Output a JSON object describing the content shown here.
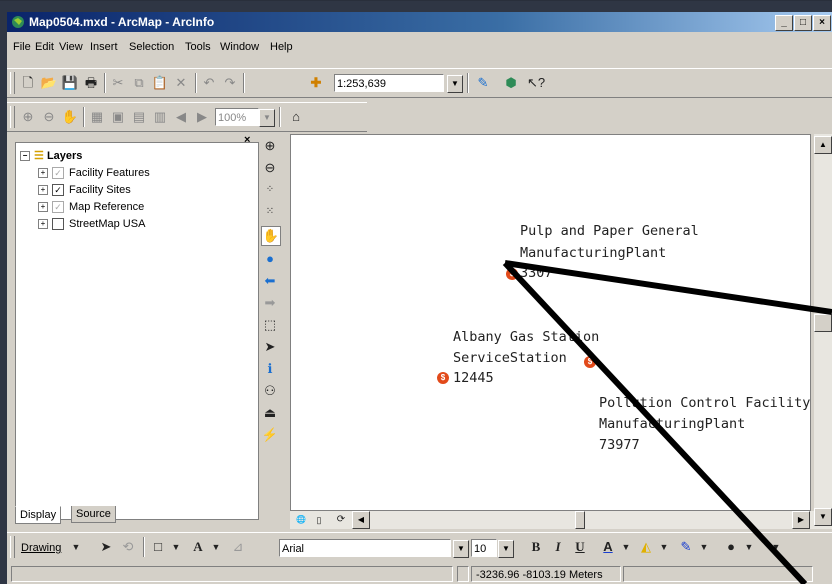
{
  "window": {
    "title": "Map0504.mxd - ArcMap - ArcInfo",
    "buttons": [
      "_",
      "□",
      "×"
    ]
  },
  "menu": [
    "File",
    "Edit",
    "View",
    "Insert",
    "Selection",
    "Tools",
    "Window",
    "Help"
  ],
  "standard_toolbar": {
    "scale": "1:253,639"
  },
  "toc": {
    "root": "Layers",
    "layers": [
      {
        "name": "Facility Features",
        "checked": true,
        "dim": true
      },
      {
        "name": "Facility Sites",
        "checked": true,
        "dim": false
      },
      {
        "name": "Map Reference",
        "checked": true,
        "dim": true
      },
      {
        "name": "StreetMap USA",
        "checked": false,
        "dim": false
      }
    ],
    "tabs": [
      "Display",
      "Source"
    ]
  },
  "map": {
    "labels": {
      "pulp_l1": "Pulp and Paper General",
      "pulp_l2": "ManufacturingPlant",
      "pulp_l3": "3307",
      "albany_l1": "Albany Gas Station",
      "albany_l2": "ServiceStation",
      "albany_l3": "12445",
      "poll_l1": "Pollution Control Facility",
      "poll_l2": "ManufacturingPlant",
      "poll_l3": "73977"
    },
    "point_symbol": "$",
    "point_color": "#e24a1a"
  },
  "layout_toolbar": {
    "zoom": "100%"
  },
  "drawing_toolbar": {
    "drawing_label": "Drawing",
    "font_name": "Arial",
    "font_size": "10",
    "bold": "B",
    "italic": "I",
    "underline": "U",
    "font_color_letter": "A"
  },
  "status": {
    "coordinates": "-3236.96  -8103.19 Meters"
  }
}
